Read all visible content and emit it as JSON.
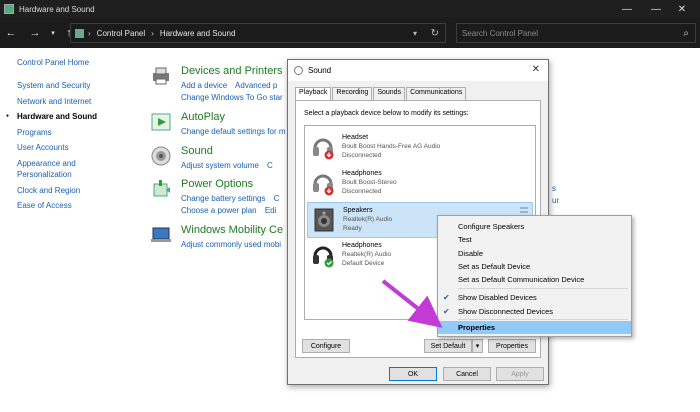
{
  "window": {
    "title": "Hardware and Sound",
    "controls": [
      "—",
      "☐",
      "✕"
    ]
  },
  "address": {
    "crumbs": [
      "Control Panel",
      "Hardware and Sound"
    ],
    "search_placeholder": "Search Control Panel"
  },
  "leftnav": {
    "home": "Control Panel Home",
    "items": [
      "System and Security",
      "Network and Internet",
      "Hardware and Sound",
      "Programs",
      "User Accounts",
      "Appearance and",
      "Personalization",
      "Clock and Region",
      "Ease of Access"
    ]
  },
  "categories": [
    {
      "title": "Devices and Printers",
      "links": [
        "Add a device",
        "Advanced p"
      ],
      "links2": [
        "Change Windows To Go star"
      ],
      "icon": "printer-icon"
    },
    {
      "title": "AutoPlay",
      "links": [
        "Change default settings for m"
      ],
      "icon": "autoplay-icon"
    },
    {
      "title": "Sound",
      "links": [
        "Adjust system volume",
        "C"
      ],
      "icon": "speaker-icon"
    },
    {
      "title": "Power Options",
      "links": [
        "Change battery settings",
        "C"
      ],
      "links2": [
        "Choose a power plan",
        "Edi"
      ],
      "icon": "power-icon"
    },
    {
      "title": "Windows Mobility Ce",
      "links": [
        "Adjust commonly used mobi"
      ],
      "icon": "mobility-icon"
    }
  ],
  "right_links": [
    "s",
    "ur"
  ],
  "dialog": {
    "title": "Sound",
    "tabs": [
      "Playback",
      "Recording",
      "Sounds",
      "Communications"
    ],
    "instruction": "Select a playback device below to modify its settings:",
    "devices": [
      {
        "name": "Headset",
        "sub": "Boult Boost Hands-Free AG Audio",
        "status": "Disconnected",
        "badge": "red-down"
      },
      {
        "name": "Headphones",
        "sub": "Boult Boost-Stereo",
        "status": "Disconnected",
        "badge": "red-down"
      },
      {
        "name": "Speakers",
        "sub": "Realtek(R) Audio",
        "status": "Ready",
        "badge": "none"
      },
      {
        "name": "Headphones",
        "sub": "Realtek(R) Audio",
        "status": "Default Device",
        "badge": "green-check"
      }
    ],
    "configure_label": "Configure",
    "set_default_label": "Set Default",
    "properties_label": "Properties",
    "ok_label": "OK",
    "cancel_label": "Cancel",
    "apply_label": "Apply"
  },
  "context_menu": {
    "items": [
      {
        "label": "Configure Speakers",
        "checked": false
      },
      {
        "label": "Test",
        "checked": false
      },
      {
        "label": "Disable",
        "checked": false
      },
      {
        "label": "Set as Default Device",
        "checked": false
      },
      {
        "label": "Set as Default Communication Device",
        "checked": false
      },
      {
        "label": "Show Disabled Devices",
        "checked": true
      },
      {
        "label": "Show Disconnected Devices",
        "checked": true
      },
      {
        "label": "Properties",
        "checked": false,
        "highlighted": true
      }
    ]
  },
  "colors": {
    "link": "#1a5fb4",
    "category": "#1e7a24",
    "arrow": "#c23bd4",
    "highlight": "#91c9f7"
  }
}
